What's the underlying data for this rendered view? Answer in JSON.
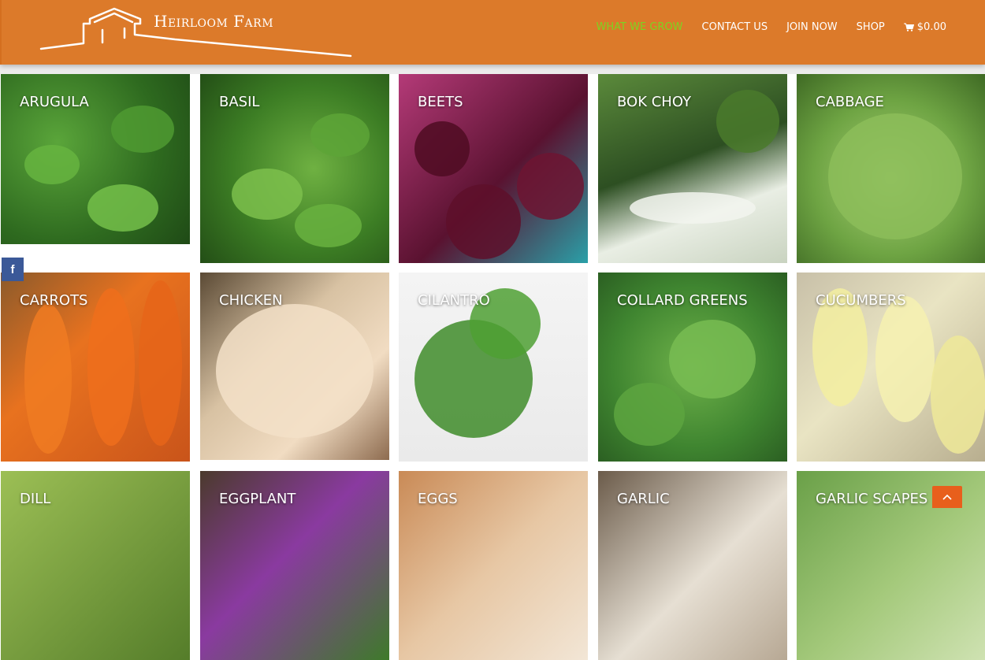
{
  "brand": {
    "logo_text": "Heirloom Farm"
  },
  "nav": {
    "items": [
      {
        "label": "WHAT WE GROW",
        "active": true
      },
      {
        "label": "CONTACT US",
        "active": false
      },
      {
        "label": "JOIN NOW",
        "active": false
      },
      {
        "label": "SHOP",
        "active": false
      }
    ],
    "cart_total": "$0.00",
    "cart_icon": "shopping-cart-icon"
  },
  "social": {
    "icon": "facebook-icon",
    "glyph": "f"
  },
  "scroll_top": {
    "icon": "chevron-up-icon"
  },
  "colors": {
    "header": "#dc7a2a",
    "active_nav": "#7ed321",
    "facebook": "#3b5998",
    "scroll_top": "#e85f1c"
  },
  "products": [
    {
      "name": "ARUGULA"
    },
    {
      "name": "BASIL"
    },
    {
      "name": "BEETS"
    },
    {
      "name": "BOK CHOY"
    },
    {
      "name": "CABBAGE"
    },
    {
      "name": "CARROTS"
    },
    {
      "name": "CHICKEN"
    },
    {
      "name": "CILANTRO"
    },
    {
      "name": "COLLARD GREENS"
    },
    {
      "name": "CUCUMBERS"
    },
    {
      "name": "DILL"
    },
    {
      "name": "EGGPLANT"
    },
    {
      "name": "EGGS"
    },
    {
      "name": "GARLIC"
    },
    {
      "name": "GARLIC SCAPES"
    }
  ]
}
